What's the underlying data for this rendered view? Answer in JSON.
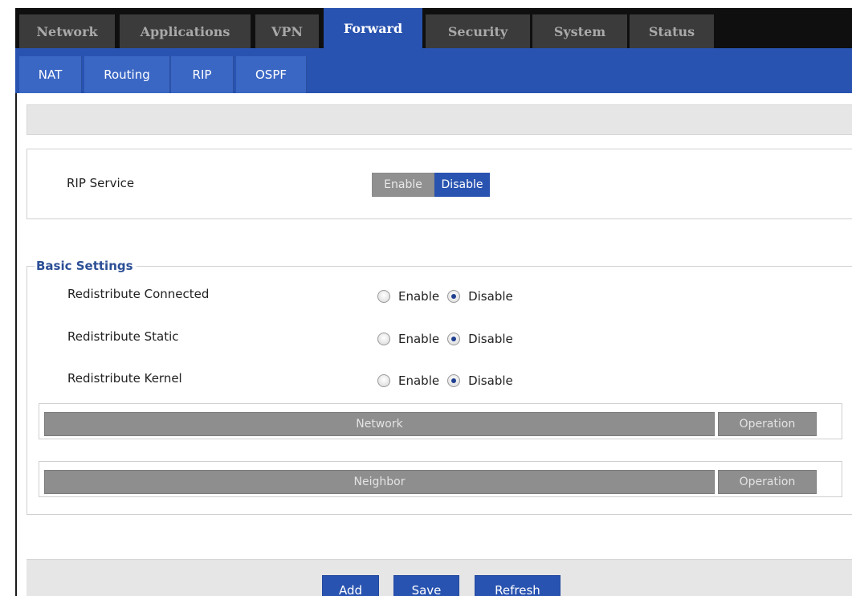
{
  "top_nav": {
    "tabs": [
      {
        "label": "Network"
      },
      {
        "label": "Applications"
      },
      {
        "label": "VPN"
      },
      {
        "label": "Forward",
        "active": true
      },
      {
        "label": "Security"
      },
      {
        "label": "System"
      },
      {
        "label": "Status"
      }
    ]
  },
  "sub_nav": {
    "tabs": [
      {
        "label": "NAT"
      },
      {
        "label": "Routing"
      },
      {
        "label": "RIP",
        "active": true
      },
      {
        "label": "OSPF"
      }
    ]
  },
  "rip_service": {
    "label": "RIP Service",
    "enable_label": "Enable",
    "disable_label": "Disable",
    "selected": "Disable"
  },
  "basic_settings": {
    "legend": "Basic Settings",
    "rows": [
      {
        "label": "Redistribute Connected",
        "enable_label": "Enable",
        "disable_label": "Disable",
        "selected": "Disable"
      },
      {
        "label": "Redistribute Static",
        "enable_label": "Enable",
        "disable_label": "Disable",
        "selected": "Disable"
      },
      {
        "label": "Redistribute Kernel",
        "enable_label": "Enable",
        "disable_label": "Disable",
        "selected": "Disable"
      }
    ]
  },
  "network_table": {
    "columns": [
      "Network",
      "Operation"
    ]
  },
  "neighbor_table": {
    "columns": [
      "Neighbor",
      "Operation"
    ]
  },
  "buttons": {
    "add": "Add",
    "save": "Save",
    "refresh": "Refresh"
  },
  "colors": {
    "accent": "#2953b0",
    "nav_dark": "#0f0f0f",
    "tab_inactive": "#3b3b3b",
    "header_gray": "#8e8e8e"
  }
}
